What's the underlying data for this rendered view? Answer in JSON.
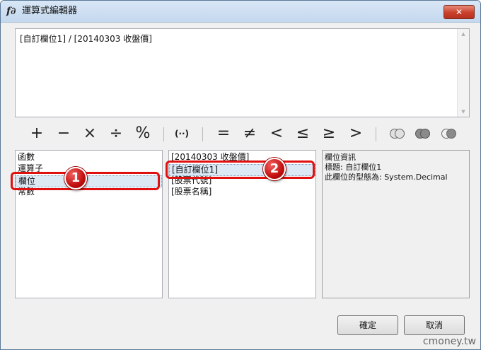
{
  "window": {
    "title": "運算式編輯器",
    "app_icon_glyph": "f∂",
    "close_glyph": "✕"
  },
  "expression": {
    "text": "[自訂欄位1] / [20140303 收盤價]"
  },
  "toolbar": {
    "ops": [
      "+",
      "−",
      "×",
      "÷",
      "%"
    ],
    "paren": "(··)",
    "comparisons": [
      "=",
      "≠",
      "<",
      "≤",
      ">",
      ">"
    ],
    "set_ops": [
      "intersect-icon",
      "union-icon",
      "difference-icon"
    ]
  },
  "categories": {
    "items": [
      "函數",
      "運算子",
      "欄位",
      "常數"
    ],
    "selected_index": 2
  },
  "fields": {
    "items": [
      "[20140303 收盤價]",
      "[自訂欄位1]",
      "[股票代號]",
      "[股票名稱]"
    ],
    "selected_index": 1
  },
  "info": {
    "lines": [
      "欄位資訊",
      "標題: 自訂欄位1",
      "此欄位的型態為: System.Decimal"
    ]
  },
  "annotations": {
    "badge1": "1",
    "badge2": "2",
    "color": "#e01010"
  },
  "buttons": {
    "ok": "確定",
    "cancel": "取消"
  },
  "watermark": "cmoney.tw"
}
